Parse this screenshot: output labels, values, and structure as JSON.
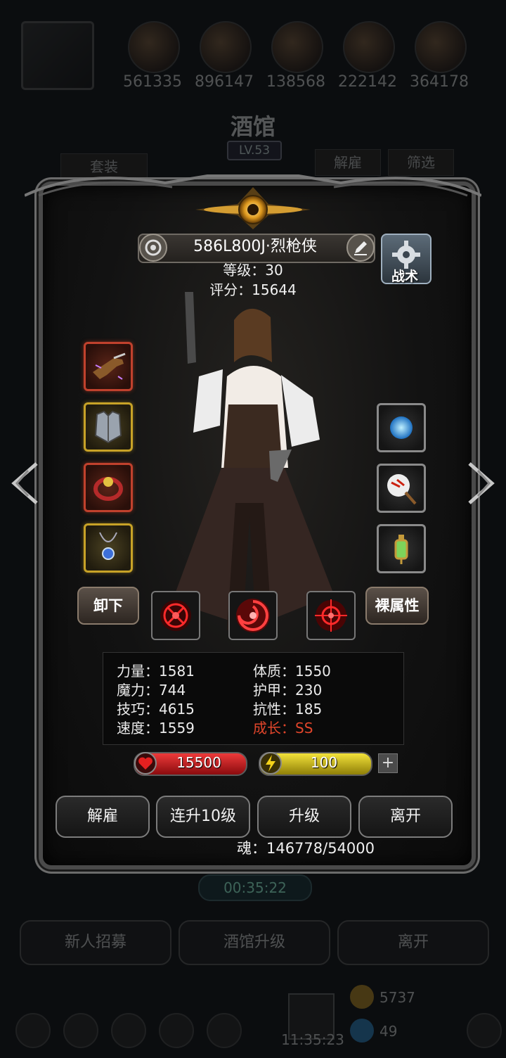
{
  "background": {
    "resources": [
      "561335",
      "896147",
      "138568",
      "222142",
      "364178"
    ],
    "title": "酒馆",
    "level_badge": "LV.53",
    "tab_set": "套装",
    "tab_dismiss": "解雇",
    "tab_filter": "筛选",
    "timer": "00:35:22",
    "buttons": [
      "新人招募",
      "酒馆升级",
      "离开"
    ],
    "coin_count": "5737",
    "gem_count": "49",
    "bottom_timer": "11:35:23"
  },
  "hero": {
    "name": "586L800J·烈枪侠",
    "level": "等级：30",
    "score": "评分：15644",
    "tactic_label": "战术",
    "unequip_label": "卸下",
    "base_attr_label": "裸属性"
  },
  "stats": {
    "strength": "力量：1581",
    "constitution": "体质：1550",
    "magic": "魔力：744",
    "armor": "护甲：230",
    "skill": "技巧：4615",
    "resistance": "抗性：185",
    "speed": "速度：1559",
    "growth": "成长：SS"
  },
  "bars": {
    "hp": "15500",
    "energy": "100",
    "plus": "+"
  },
  "actions": {
    "dismiss": "解雇",
    "upgrade10": "连升10级",
    "upgrade": "升级",
    "leave": "离开"
  },
  "soul": "魂：146778/54000",
  "icons": {
    "left_equipment": [
      "pistol-icon",
      "chest-armor-icon",
      "ring-icon",
      "amulet-icon"
    ],
    "right_equipment": [
      "blue-orb-icon",
      "fan-icon",
      "lantern-icon"
    ],
    "skills": [
      "crosshair-skill-icon",
      "vortex-skill-icon",
      "target-skill-icon"
    ]
  },
  "colors": {
    "hp_bar": "#c8161b",
    "energy_bar": "#d8c51a",
    "growth_text": "#e0452b"
  }
}
